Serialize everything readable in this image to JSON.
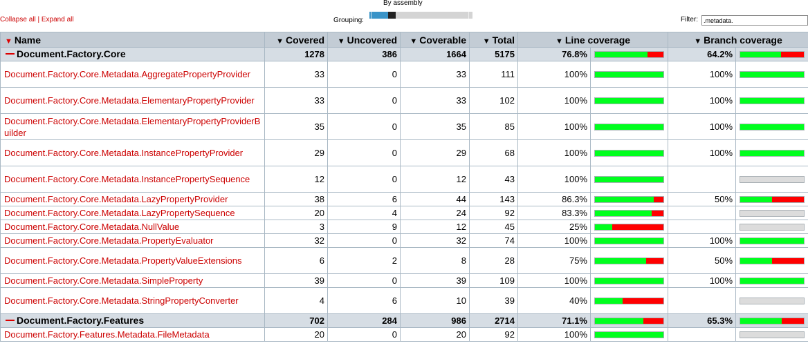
{
  "toolbar": {
    "collapse_all": "Collapse all",
    "separator": "|",
    "expand_all": "Expand all",
    "grouping_label": "Grouping:",
    "grouping_value": "By assembly",
    "filter_label": "Filter:",
    "filter_value": ".metadata."
  },
  "colors": {
    "covered": "#00ff1e",
    "uncovered": "#ff0000",
    "na": "#dcdcdc",
    "link": "#cc0000",
    "header_bg": "#c3ccd5",
    "group_bg": "#d6dde4"
  },
  "columns": [
    {
      "label": "Name",
      "sort_icon": "triangle-down-icon",
      "active": true
    },
    {
      "label": "Covered",
      "sort_icon": "triangle-down-icon"
    },
    {
      "label": "Uncovered",
      "sort_icon": "triangle-down-icon"
    },
    {
      "label": "Coverable",
      "sort_icon": "triangle-down-icon"
    },
    {
      "label": "Total",
      "sort_icon": "triangle-down-icon"
    },
    {
      "label": "Line coverage",
      "sort_icon": "triangle-down-icon"
    },
    {
      "label": "Branch coverage",
      "sort_icon": "triangle-down-icon"
    }
  ],
  "rows": [
    {
      "type": "group",
      "name": "Document.Factory.Core",
      "covered": "1278",
      "uncovered": "386",
      "coverable": "1664",
      "total": "5175",
      "line": "76.8%",
      "line_pct": 76.8,
      "branch": "64.2%",
      "branch_pct": 64.2
    },
    {
      "type": "item",
      "tall": true,
      "name": "Document.Factory.Core.Metadata.AggregatePropertyProvider",
      "covered": "33",
      "uncovered": "0",
      "coverable": "33",
      "total": "111",
      "line": "100%",
      "line_pct": 100,
      "branch": "100%",
      "branch_pct": 100
    },
    {
      "type": "item",
      "tall": true,
      "name": "Document.Factory.Core.Metadata.ElementaryPropertyProvider",
      "covered": "33",
      "uncovered": "0",
      "coverable": "33",
      "total": "102",
      "line": "100%",
      "line_pct": 100,
      "branch": "100%",
      "branch_pct": 100
    },
    {
      "type": "item",
      "tall": true,
      "name": "Document.Factory.Core.Metadata.ElementaryPropertyProviderBuilder",
      "covered": "35",
      "uncovered": "0",
      "coverable": "35",
      "total": "85",
      "line": "100%",
      "line_pct": 100,
      "branch": "100%",
      "branch_pct": 100
    },
    {
      "type": "item",
      "tall": true,
      "name": "Document.Factory.Core.Metadata.InstancePropertyProvider",
      "covered": "29",
      "uncovered": "0",
      "coverable": "29",
      "total": "68",
      "line": "100%",
      "line_pct": 100,
      "branch": "100%",
      "branch_pct": 100
    },
    {
      "type": "item",
      "tall": true,
      "name": "Document.Factory.Core.Metadata.InstancePropertySequence",
      "covered": "12",
      "uncovered": "0",
      "coverable": "12",
      "total": "43",
      "line": "100%",
      "line_pct": 100,
      "branch": "",
      "branch_pct": null
    },
    {
      "type": "item",
      "tall": false,
      "name": "Document.Factory.Core.Metadata.LazyPropertyProvider",
      "covered": "38",
      "uncovered": "6",
      "coverable": "44",
      "total": "143",
      "line": "86.3%",
      "line_pct": 86.3,
      "branch": "50%",
      "branch_pct": 50
    },
    {
      "type": "item",
      "tall": false,
      "name": "Document.Factory.Core.Metadata.LazyPropertySequence",
      "covered": "20",
      "uncovered": "4",
      "coverable": "24",
      "total": "92",
      "line": "83.3%",
      "line_pct": 83.3,
      "branch": "",
      "branch_pct": null
    },
    {
      "type": "item",
      "tall": false,
      "name": "Document.Factory.Core.Metadata.NullValue",
      "covered": "3",
      "uncovered": "9",
      "coverable": "12",
      "total": "45",
      "line": "25%",
      "line_pct": 25,
      "branch": "",
      "branch_pct": null
    },
    {
      "type": "item",
      "tall": false,
      "name": "Document.Factory.Core.Metadata.PropertyEvaluator",
      "covered": "32",
      "uncovered": "0",
      "coverable": "32",
      "total": "74",
      "line": "100%",
      "line_pct": 100,
      "branch": "100%",
      "branch_pct": 100
    },
    {
      "type": "item",
      "tall": true,
      "name": "Document.Factory.Core.Metadata.PropertyValueExtensions",
      "covered": "6",
      "uncovered": "2",
      "coverable": "8",
      "total": "28",
      "line": "75%",
      "line_pct": 75,
      "branch": "50%",
      "branch_pct": 50
    },
    {
      "type": "item",
      "tall": false,
      "name": "Document.Factory.Core.Metadata.SimpleProperty",
      "covered": "39",
      "uncovered": "0",
      "coverable": "39",
      "total": "109",
      "line": "100%",
      "line_pct": 100,
      "branch": "100%",
      "branch_pct": 100
    },
    {
      "type": "item",
      "tall": true,
      "name": "Document.Factory.Core.Metadata.StringPropertyConverter",
      "covered": "4",
      "uncovered": "6",
      "coverable": "10",
      "total": "39",
      "line": "40%",
      "line_pct": 40,
      "branch": "",
      "branch_pct": null
    },
    {
      "type": "group",
      "name": "Document.Factory.Features",
      "covered": "702",
      "uncovered": "284",
      "coverable": "986",
      "total": "2714",
      "line": "71.1%",
      "line_pct": 71.1,
      "branch": "65.3%",
      "branch_pct": 65.3
    },
    {
      "type": "item",
      "tall": false,
      "name": "Document.Factory.Features.Metadata.FileMetadata",
      "covered": "20",
      "uncovered": "0",
      "coverable": "20",
      "total": "92",
      "line": "100%",
      "line_pct": 100,
      "branch": "",
      "branch_pct": null
    }
  ]
}
